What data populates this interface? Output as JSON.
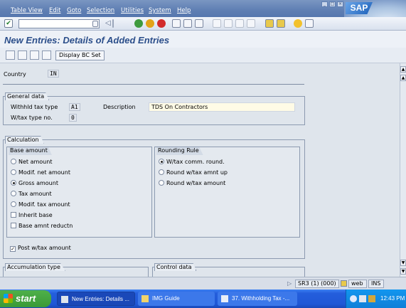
{
  "menu": {
    "items": [
      "Table View",
      "Edit",
      "Goto",
      "Selection",
      "Utilities",
      "System",
      "Help"
    ]
  },
  "brand": {
    "logo_text": "SAP"
  },
  "screen": {
    "title": "New Entries: Details of Added Entries"
  },
  "app_toolbar": {
    "bc_set_label": "Display BC Set"
  },
  "header": {
    "country_label": "Country",
    "country_value": "IN"
  },
  "general_data": {
    "title": "General data",
    "withhld_tax_type_label": "Withhld tax type",
    "withhld_tax_type_value": "A1",
    "description_label": "Description",
    "description_value": "TDS On Contractors",
    "wtax_type_no_label": "W/tax type no.",
    "wtax_type_no_value": "0"
  },
  "calculation": {
    "title": "Calculation",
    "base_amount": {
      "title": "Base amount",
      "options": [
        "Net amount",
        "Modif. net amount",
        "Gross amount",
        "Tax amount",
        "Modif. tax amount"
      ],
      "selected": "Gross amount",
      "checkboxes": [
        "Inherit base",
        "Base amnt reductn"
      ]
    },
    "rounding_rule": {
      "title": "Rounding Rule",
      "options": [
        "W/tax comm. round.",
        "Round w/tax amnt up",
        "Round w/tax amount"
      ],
      "selected": "W/tax comm. round."
    },
    "post_wtax_amount_label": "Post w/tax amount",
    "post_wtax_amount_checked": true
  },
  "accumulation_type": {
    "title": "Accumulation type"
  },
  "control_data": {
    "title": "Control data"
  },
  "status_bar": {
    "system": "SR3 (1) (000)",
    "server": "web",
    "mode": "INS"
  },
  "taskbar": {
    "start_label": "start",
    "tasks": [
      "New Entries: Details ...",
      "IMG Guide",
      "37. Withholding Tax -..."
    ],
    "clock": "12:43 PM"
  },
  "colors": {
    "title": "#2b4e8a",
    "menubar": "#5f7fb3",
    "taskbar": "#245edc",
    "start": "#3a9a36"
  }
}
